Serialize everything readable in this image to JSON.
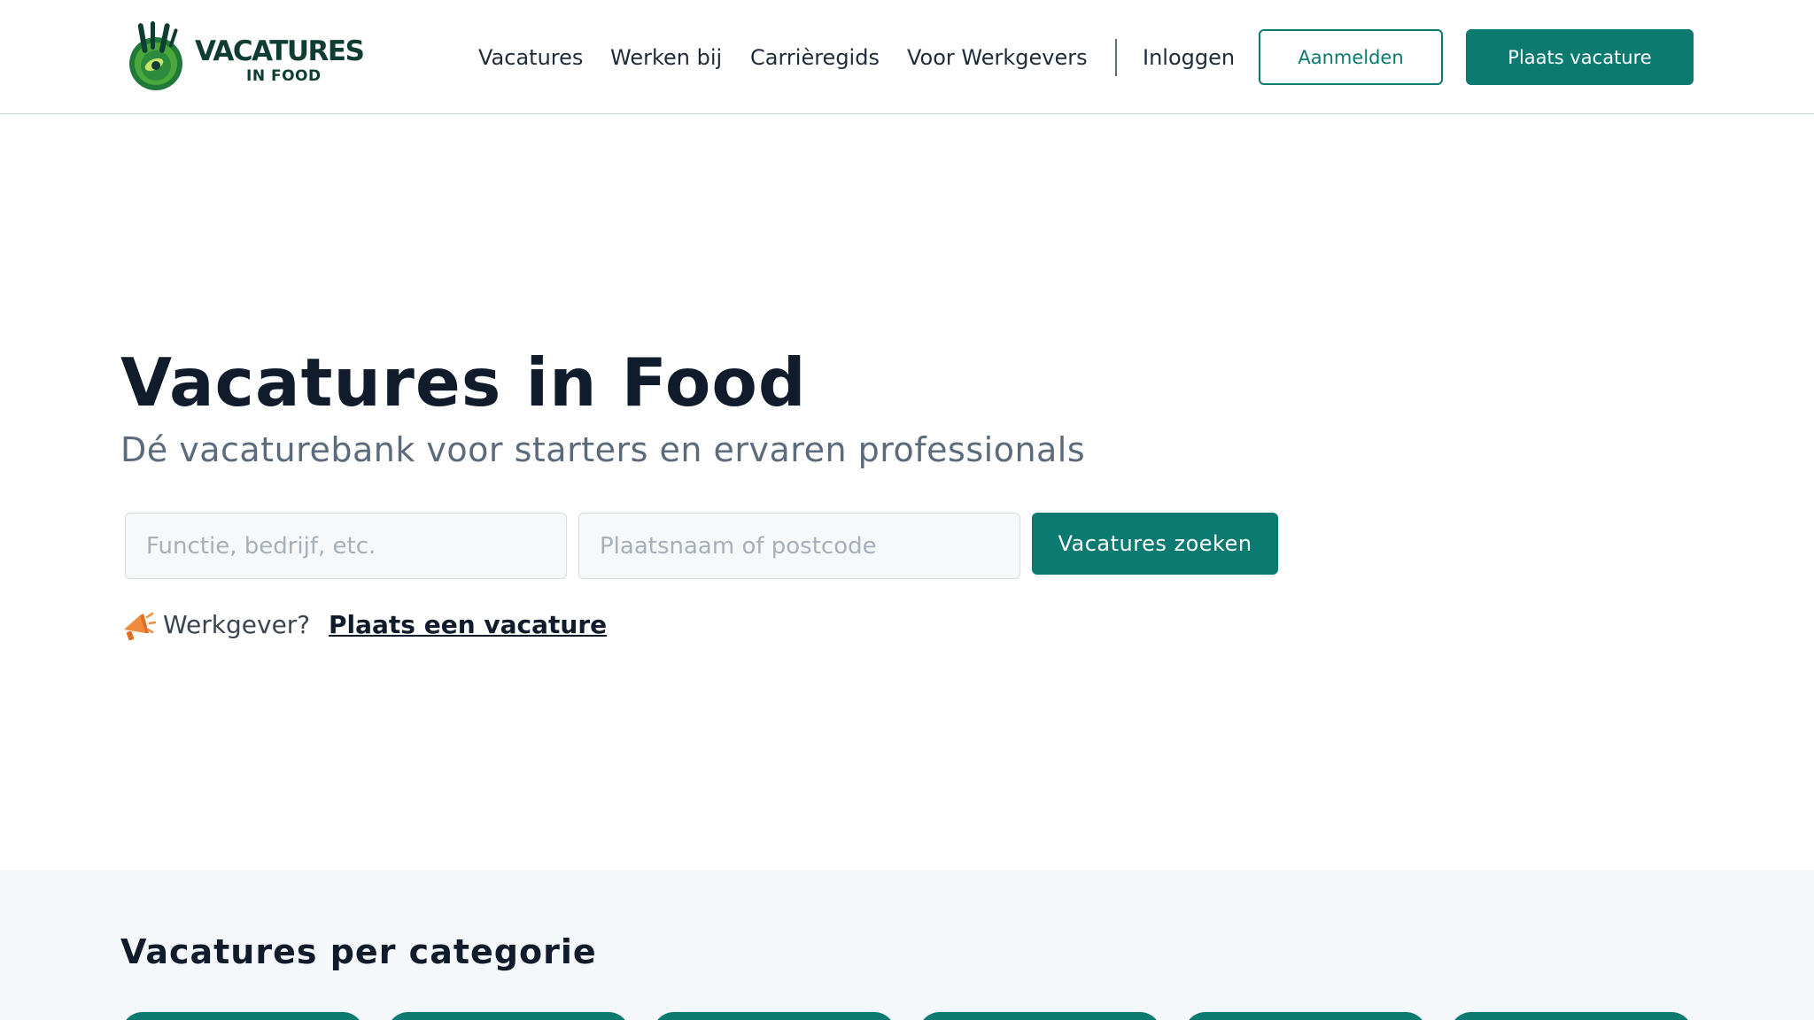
{
  "brand": {
    "logo_line1": "VACATURES",
    "logo_line2": "IN FOOD",
    "primary_color": "#0b7a70",
    "logo_color": "#0f3d33",
    "icon": "vacatures-in-food-logo"
  },
  "nav": {
    "items": [
      {
        "label": "Vacatures"
      },
      {
        "label": "Werken bij"
      },
      {
        "label": "Carrièregids"
      },
      {
        "label": "Voor Werkgevers"
      }
    ],
    "login_label": "Inloggen",
    "signup_label": "Aanmelden",
    "post_job_label": "Plaats vacature"
  },
  "hero": {
    "title": "Vacatures in Food",
    "subtitle": "Dé vacaturebank voor starters en ervaren professionals",
    "search": {
      "what_placeholder": "Functie, bedrijf, etc.",
      "what_value": "",
      "where_placeholder": "Plaatsnaam of postcode",
      "where_value": "",
      "button_label": "Vacatures zoeken"
    },
    "employer_question": "Werkgever?",
    "employer_link": "Plaats een vacature",
    "employer_icon": "megaphone-icon"
  },
  "categories": {
    "title": "Vacatures per categorie"
  }
}
